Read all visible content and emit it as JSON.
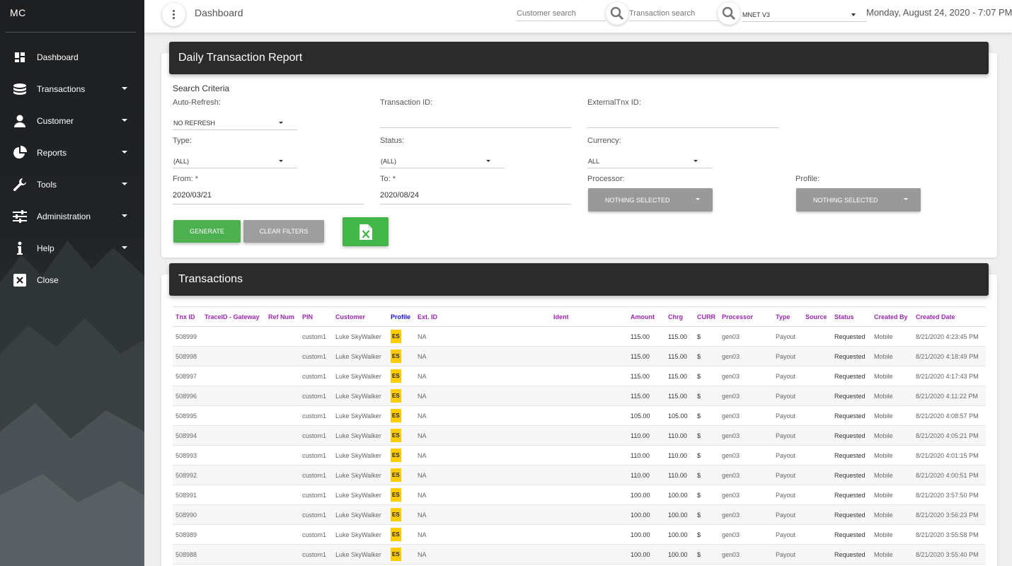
{
  "app": {
    "logo": "MC"
  },
  "sidebar": {
    "items": [
      {
        "label": "Dashboard",
        "icon": "dashboard-icon",
        "has_caret": false
      },
      {
        "label": "Transactions",
        "icon": "coins-icon",
        "has_caret": true
      },
      {
        "label": "Customer",
        "icon": "user-icon",
        "has_caret": true
      },
      {
        "label": "Reports",
        "icon": "pie-chart-icon",
        "has_caret": true
      },
      {
        "label": "Tools",
        "icon": "wrench-icon",
        "has_caret": true
      },
      {
        "label": "Administration",
        "icon": "sliders-icon",
        "has_caret": true
      },
      {
        "label": "Help",
        "icon": "info-icon",
        "has_caret": true
      },
      {
        "label": "Close",
        "icon": "close-box-icon",
        "has_caret": false
      }
    ]
  },
  "header": {
    "title": "Dashboard",
    "customer_search_placeholder": "Customer search",
    "transaction_search_placeholder": "Transaction search",
    "environment": "MNET V3",
    "datetime": "Monday, August 24, 2020 - 7:07 PM"
  },
  "report": {
    "title": "Daily Transaction Report",
    "criteria_title": "Search Criteria",
    "auto_refresh_label": "Auto-Refresh:",
    "auto_refresh_value": "NO REFRESH",
    "transaction_id_label": "Transaction ID:",
    "transaction_id_value": "",
    "external_id_label": "ExternalTnx ID:",
    "external_id_value": "",
    "type_label": "Type:",
    "type_value": "(ALL)",
    "status_label": "Status:",
    "status_value": "(ALL)",
    "currency_label": "Currency:",
    "currency_value": "ALL",
    "from_label": "From: *",
    "from_value": "2020/03/21",
    "to_label": "To: *",
    "to_value": "2020/08/24",
    "processor_label": "Processor:",
    "processor_value": "NOTHING SELECTED",
    "profile_label": "Profile:",
    "profile_value": "NOTHING SELECTED",
    "generate_label": "GENERATE",
    "clear_label": "CLEAR FILTERS",
    "export_icon": "excel-icon",
    "colors": {
      "generate": "#4caf50",
      "clear": "#9e9e9e",
      "export": "#43b649"
    }
  },
  "transactions": {
    "title": "Transactions",
    "columns": [
      "Tnx ID",
      "TraceID - Gateway",
      "Ref Num",
      "PIN",
      "Customer",
      "Profile",
      "Ext. ID",
      "Ident",
      "Amount",
      "Chrg",
      "CURR",
      "Processor",
      "Type",
      "Source",
      "Status",
      "Created By",
      "Created Date"
    ],
    "rows": [
      [
        "508999",
        "",
        "",
        "custom1",
        "Luke SkyWalker",
        "ES",
        "NA",
        "",
        "115.00",
        "115.00",
        "$",
        "gen03",
        "Payout",
        "",
        "Requested",
        "Mobile",
        "8/21/2020 4:23:45 PM"
      ],
      [
        "508998",
        "",
        "",
        "custom1",
        "Luke SkyWalker",
        "ES",
        "NA",
        "",
        "115.00",
        "115.00",
        "$",
        "gen03",
        "Payout",
        "",
        "Requested",
        "Mobile",
        "8/21/2020 4:18:49 PM"
      ],
      [
        "508997",
        "",
        "",
        "custom1",
        "Luke SkyWalker",
        "ES",
        "NA",
        "",
        "115.00",
        "115.00",
        "$",
        "gen03",
        "Payout",
        "",
        "Requested",
        "Mobile",
        "8/21/2020 4:17:43 PM"
      ],
      [
        "508996",
        "",
        "",
        "custom1",
        "Luke SkyWalker",
        "ES",
        "NA",
        "",
        "115.00",
        "115.00",
        "$",
        "gen03",
        "Payout",
        "",
        "Requested",
        "Mobile",
        "8/21/2020 4:11:22 PM"
      ],
      [
        "508995",
        "",
        "",
        "custom1",
        "Luke SkyWalker",
        "ES",
        "NA",
        "",
        "105.00",
        "105.00",
        "$",
        "gen03",
        "Payout",
        "",
        "Requested",
        "Mobile",
        "8/21/2020 4:08:57 PM"
      ],
      [
        "508994",
        "",
        "",
        "custom1",
        "Luke SkyWalker",
        "ES",
        "NA",
        "",
        "110.00",
        "110.00",
        "$",
        "gen03",
        "Payout",
        "",
        "Requested",
        "Mobile",
        "8/21/2020 4:05:21 PM"
      ],
      [
        "508993",
        "",
        "",
        "custom1",
        "Luke SkyWalker",
        "ES",
        "NA",
        "",
        "110.00",
        "110.00",
        "$",
        "gen03",
        "Payout",
        "",
        "Requested",
        "Mobile",
        "8/21/2020 4:01:15 PM"
      ],
      [
        "508992",
        "",
        "",
        "custom1",
        "Luke SkyWalker",
        "ES",
        "NA",
        "",
        "110.00",
        "110.00",
        "$",
        "gen03",
        "Payout",
        "",
        "Requested",
        "Mobile",
        "8/21/2020 4:00:51 PM"
      ],
      [
        "508991",
        "",
        "",
        "custom1",
        "Luke SkyWalker",
        "ES",
        "NA",
        "",
        "100.00",
        "100.00",
        "$",
        "gen03",
        "Payout",
        "",
        "Requested",
        "Mobile",
        "8/21/2020 3:57:50 PM"
      ],
      [
        "508990",
        "",
        "",
        "custom1",
        "Luke SkyWalker",
        "ES",
        "NA",
        "",
        "100.00",
        "100.00",
        "$",
        "gen03",
        "Payout",
        "",
        "Requested",
        "Mobile",
        "8/21/2020 3:56:23 PM"
      ],
      [
        "508989",
        "",
        "",
        "custom1",
        "Luke SkyWalker",
        "ES",
        "NA",
        "",
        "100.00",
        "100.00",
        "$",
        "gen03",
        "Payout",
        "",
        "Requested",
        "Mobile",
        "8/21/2020 3:55:58 PM"
      ],
      [
        "508988",
        "",
        "",
        "custom1",
        "Luke SkyWalker",
        "ES",
        "NA",
        "",
        "100.00",
        "100.00",
        "$",
        "gen03",
        "Payout",
        "",
        "Requested",
        "Mobile",
        "8/21/2020 3:55:40 PM"
      ]
    ]
  }
}
